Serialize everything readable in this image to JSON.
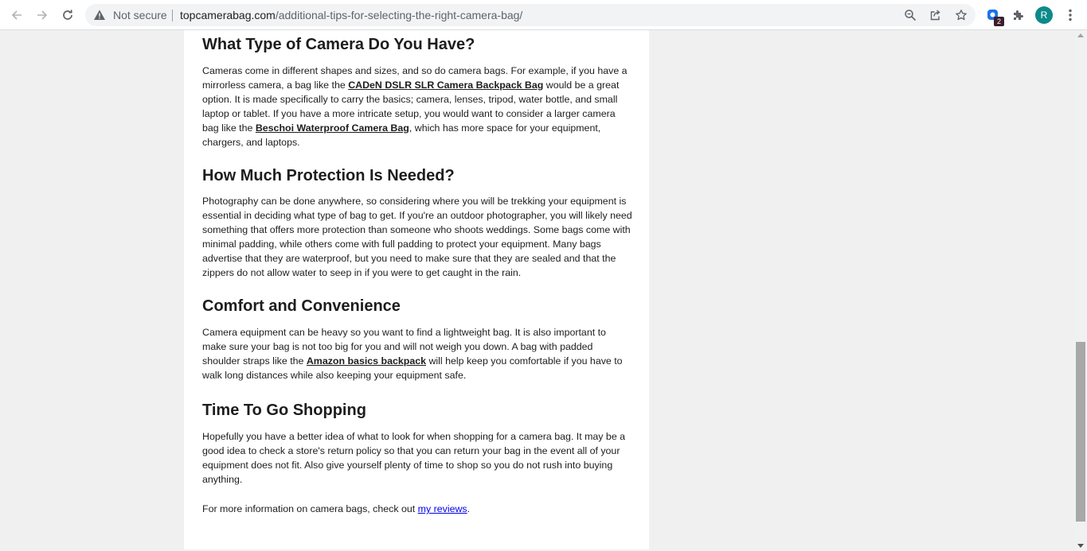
{
  "browser": {
    "security_label": "Not secure",
    "url_host": "topcamerabag.com",
    "url_path": "/additional-tips-for-selecting-the-right-camera-bag/",
    "extension_badge": "2",
    "profile_initial": "R",
    "icons": [
      "back-arrow-icon",
      "forward-arrow-icon",
      "reload-icon",
      "warning-icon",
      "zoom-icon",
      "share-icon",
      "star-icon",
      "extension-icon",
      "puzzle-icon",
      "kebab-menu-icon"
    ]
  },
  "article": {
    "sections": [
      {
        "heading": "What Type of Camera Do You Have?",
        "p_before": "Cameras come in different shapes and sizes, and so do camera bags. For example, if you have a mirrorless camera, a bag like the ",
        "link1": "CADeN DSLR SLR Camera Backpack Bag",
        "p_middle": " would be a great option. It is made specifically to carry the basics; camera, lenses, tripod, water bottle, and small laptop or tablet. If you have a more intricate setup, you would want to consider a larger camera bag like the ",
        "link2": "Beschoi Waterproof Camera Bag",
        "p_after": ", which has more space for your equipment, chargers, and laptops."
      },
      {
        "heading": "How Much Protection Is Needed?",
        "paragraph": "Photography can be done anywhere, so considering where you will be trekking your equipment is essential in deciding what type of bag to get. If you're an outdoor photographer, you will likely need something that offers more protection than someone who shoots weddings. Some bags come with minimal padding, while others come with full padding to protect your equipment. Many bags advertise that they are waterproof, but you need to make sure that they are sealed and that the zippers do not allow water to seep in if you were to get caught in the rain."
      },
      {
        "heading": "Comfort and Convenience",
        "p_before": "Camera equipment can be heavy so you want to find a lightweight bag. It is also important to make sure your bag is not too big for you and will not weigh you down. A bag with padded shoulder straps like the ",
        "link1": "Amazon basics backpack",
        "p_after": " will help keep you comfortable if you have to walk long distances while also keeping your equipment safe."
      },
      {
        "heading": "Time To Go Shopping",
        "paragraph": "Hopefully you have a better idea of what to look for when shopping for a camera bag.  It may be a good idea to check a store's return policy so that you can return your bag in the event all of your equipment does not fit.  Also give yourself plenty of time to shop so you do not rush into buying anything."
      }
    ],
    "closing": {
      "text_before": "For more information on camera bags, check out ",
      "link": "my reviews",
      "text_after": "."
    }
  }
}
